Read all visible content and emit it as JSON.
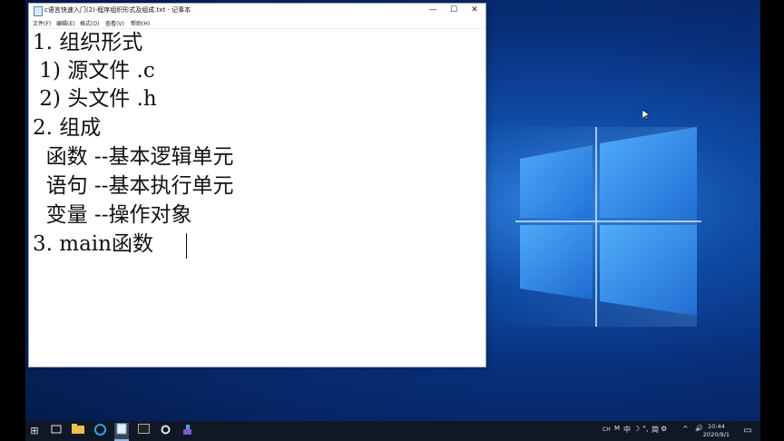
{
  "window": {
    "title": "c语言快速入门(2)-程序组织形式及组成.txt - 记事本",
    "minimize": "—",
    "maximize": "☐",
    "close": "✕"
  },
  "menu": [
    "文件(F)",
    "编辑(E)",
    "格式(O)",
    "查看(V)",
    "帮助(H)"
  ],
  "content": {
    "lines": [
      "1. 组织形式",
      " 1) 源文件 .c",
      " 2) 头文件 .h",
      "2. 组成",
      "  函数 --基本逻辑单元",
      "  语句 --基本执行单元",
      "  变量 --操作对象",
      "3. main函数"
    ]
  },
  "taskbar": {
    "start": "⊞",
    "tray_text": "CH",
    "ime_mode": "中",
    "ime_moon": "☽",
    "ime_punct": "°,",
    "ime_simplified": "简",
    "ime_settings": "⚙",
    "chevron": "^",
    "speaker": "🔊",
    "time": "10:44",
    "date": "2020/9/1"
  }
}
